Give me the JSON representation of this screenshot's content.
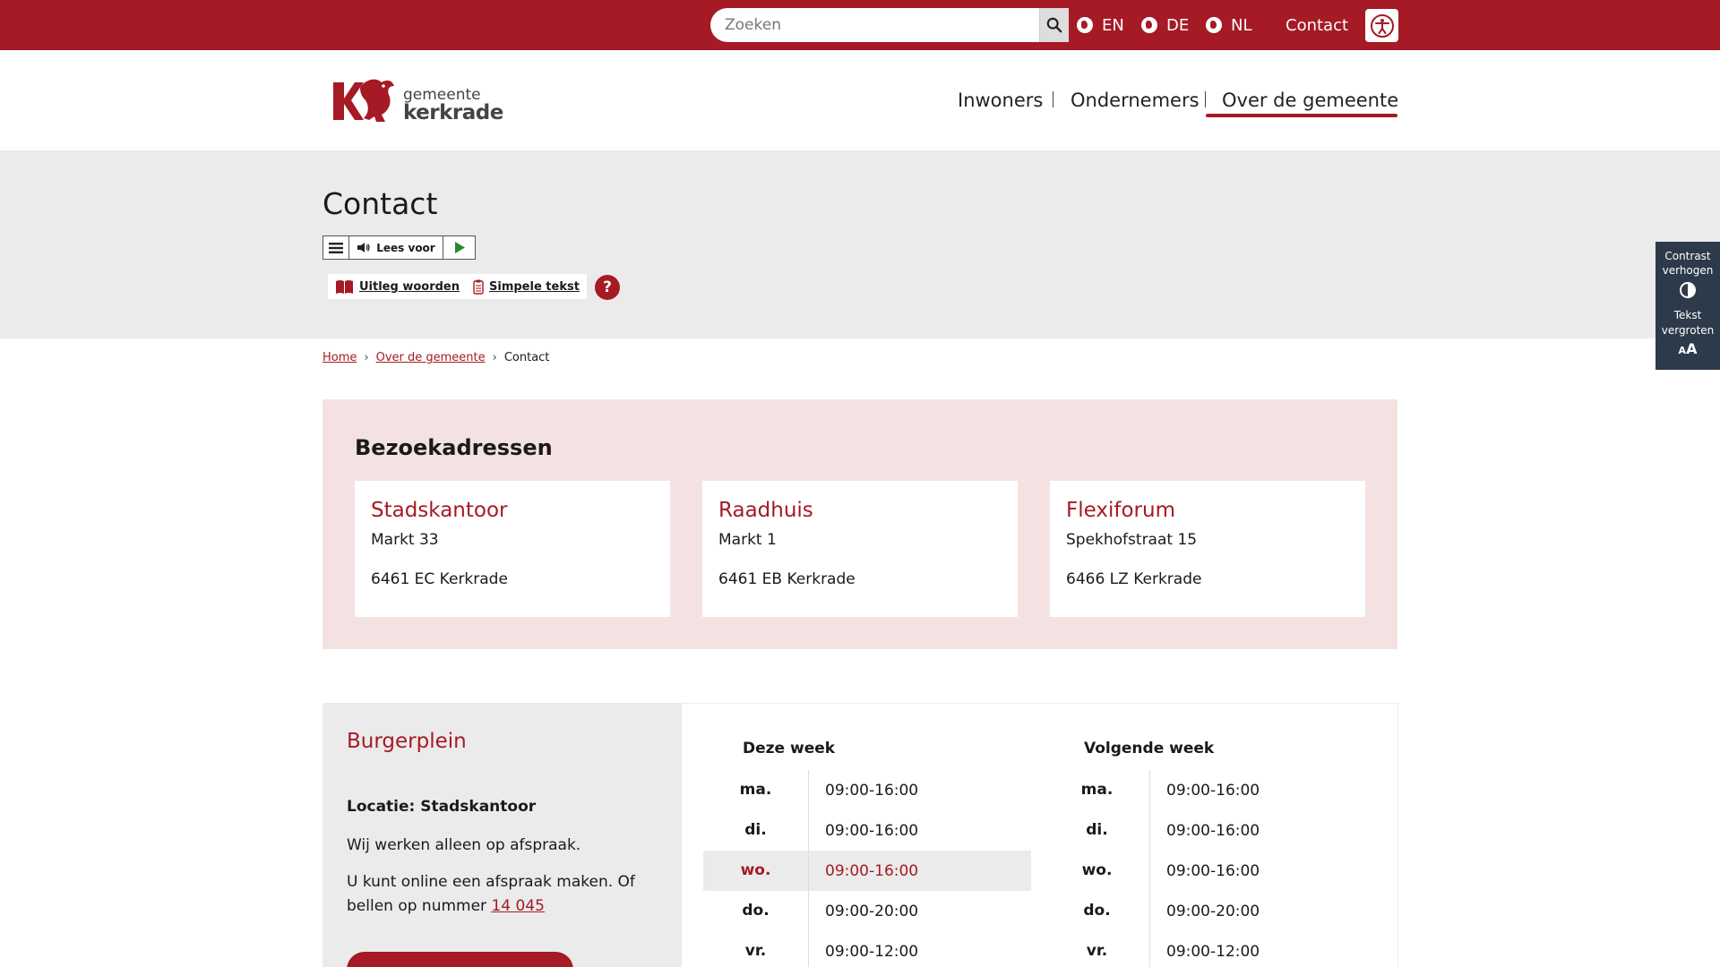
{
  "topbar": {
    "search_placeholder": "Zoeken",
    "languages": [
      "EN",
      "DE",
      "NL"
    ],
    "contact_label": "Contact"
  },
  "header": {
    "logo_small": "gemeente",
    "logo_big": "kerkrade",
    "nav": [
      "Inwoners",
      "Ondernemers",
      "Over de gemeente"
    ],
    "active_nav": "Over de gemeente"
  },
  "hero": {
    "title": "Contact",
    "read_label": "Lees voor",
    "chip_words": "Uitleg woorden",
    "chip_simple": "Simpele tekst",
    "help": "?"
  },
  "side_widget": {
    "contrast": "Contrast verhogen",
    "text": "Tekst vergroten"
  },
  "breadcrumb": {
    "home": "Home",
    "parent": "Over de gemeente",
    "current": "Contact"
  },
  "addresses": {
    "title": "Bezoekadressen",
    "cards": [
      {
        "name": "Stadskantoor",
        "street": "Markt 33",
        "city": "6461 EC Kerkrade"
      },
      {
        "name": "Raadhuis",
        "street": "Markt 1",
        "city": "6461 EB Kerkrade"
      },
      {
        "name": "Flexiforum",
        "street": "Spekhofstraat 15",
        "city": "6466 LZ Kerkrade"
      }
    ]
  },
  "burgerplein": {
    "name": "Burgerplein",
    "location": "Locatie: Stadskantoor",
    "text1": "Wij werken alleen op afspraak.",
    "text2": "U kunt online een afspraak maken. Of bellen op nummer",
    "phone": "14 045"
  },
  "hours": {
    "this_week_label": "Deze week",
    "next_week_label": "Volgende week",
    "this_week": [
      {
        "day": "ma.",
        "time": "09:00-16:00"
      },
      {
        "day": "di.",
        "time": "09:00-16:00"
      },
      {
        "day": "wo.",
        "time": "09:00-16:00",
        "today": true
      },
      {
        "day": "do.",
        "time": "09:00-20:00"
      },
      {
        "day": "vr.",
        "time": "09:00-12:00"
      }
    ],
    "next_week": [
      {
        "day": "ma.",
        "time": "09:00-16:00"
      },
      {
        "day": "di.",
        "time": "09:00-16:00"
      },
      {
        "day": "wo.",
        "time": "09:00-16:00"
      },
      {
        "day": "do.",
        "time": "09:00-20:00"
      },
      {
        "day": "vr.",
        "time": "09:00-12:00"
      }
    ]
  },
  "colors": {
    "brand": "#a51a24",
    "hero_bg": "#ebebeb",
    "address_bg": "#f4e2e3",
    "widget_bg": "#2c3a4b"
  }
}
